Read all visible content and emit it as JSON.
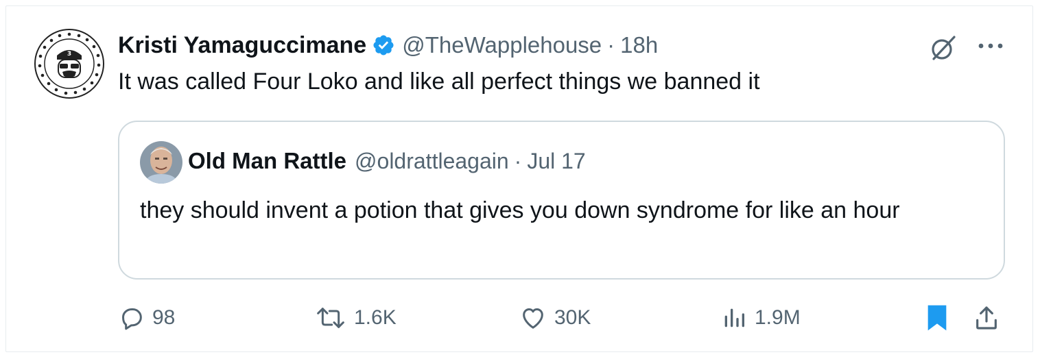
{
  "tweet": {
    "author_name": "Kristi Yamaguccimane",
    "handle": "@TheWapplehouse",
    "separator": "·",
    "time": "18h",
    "text": "It was called Four Loko and like all perfect things we banned it",
    "avatar_label": "S. RAISE HELL PRAISE DALE BURN DOWN APPLEBEE'S"
  },
  "quoted_tweet": {
    "author_name": "Old Man Rattle",
    "handle": "@oldrattleagain",
    "separator": "·",
    "time": "Jul 17",
    "text": "they should invent a potion that gives you down syndrome for like an hour"
  },
  "actions": {
    "replies": "98",
    "reposts": "1.6K",
    "likes": "30K",
    "views": "1.9M"
  },
  "colors": {
    "verified_blue": "#1d9bf0",
    "bookmark_blue": "#1d9bf0",
    "secondary_text": "#536471",
    "quote_border": "#cfd9de"
  },
  "icons": [
    "verified-badge-icon",
    "grok-icon",
    "more-icon",
    "reply-icon",
    "repost-icon",
    "like-icon",
    "views-icon",
    "bookmark-icon",
    "share-icon"
  ]
}
